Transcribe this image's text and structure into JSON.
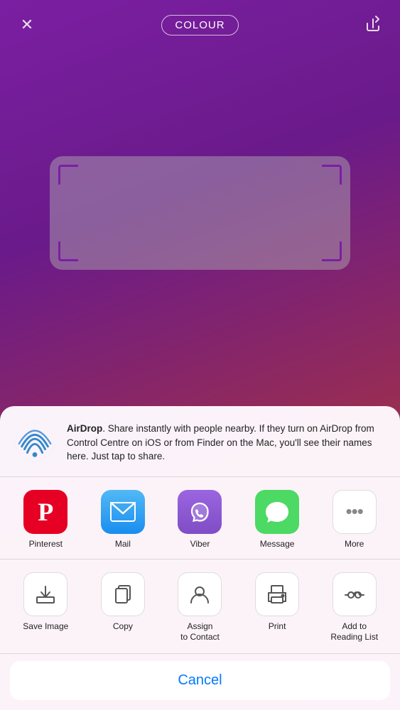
{
  "background": {
    "gradient": "linear-gradient(160deg, #7b1fa2, #a0304a)"
  },
  "topBar": {
    "title": "COLOUR",
    "closeLabel": "×",
    "shareLabel": "↑"
  },
  "airdrop": {
    "title": "AirDrop",
    "description": ". Share instantly with people nearby. If they turn on AirDrop from Control Centre on iOS or from Finder on the Mac, you'll see their names here. Just tap to share."
  },
  "apps": [
    {
      "id": "pinterest",
      "label": "Pinterest",
      "iconClass": "pinterest"
    },
    {
      "id": "mail",
      "label": "Mail",
      "iconClass": "mail"
    },
    {
      "id": "viber",
      "label": "Viber",
      "iconClass": "viber"
    },
    {
      "id": "message",
      "label": "Message",
      "iconClass": "message"
    },
    {
      "id": "more",
      "label": "More",
      "iconClass": "more"
    }
  ],
  "actions": [
    {
      "id": "save-image",
      "label": "Save Image"
    },
    {
      "id": "copy",
      "label": "Copy"
    },
    {
      "id": "assign-to-contact",
      "label": "Assign\nto Contact"
    },
    {
      "id": "print",
      "label": "Print"
    },
    {
      "id": "add-to-reading-list",
      "label": "Add to\nReading List"
    }
  ],
  "cancelLabel": "Cancel"
}
